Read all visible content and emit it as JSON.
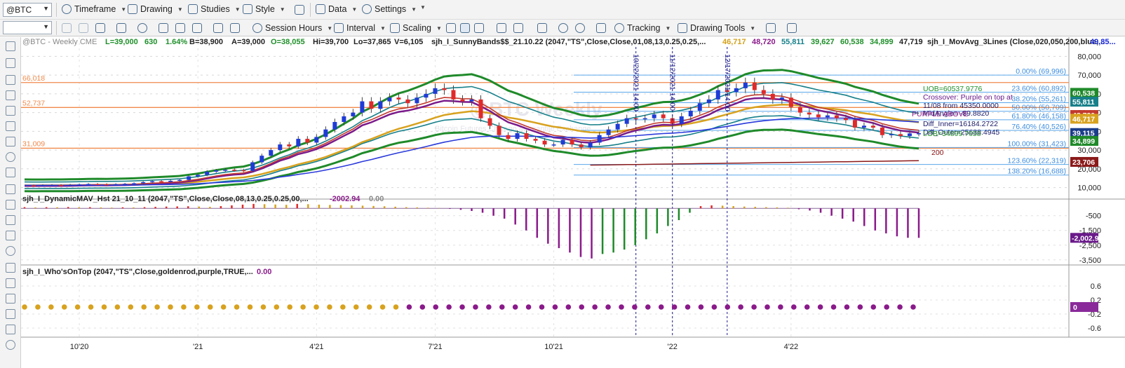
{
  "toolbar": {
    "symbol": "@BTC",
    "timeframe": "Timeframe",
    "drawing": "Drawing",
    "studies": "Studies",
    "style": "Style",
    "data": "Data",
    "settings": "Settings",
    "session_hours": "Session Hours",
    "interval": "Interval",
    "scaling": "Scaling",
    "tracking": "Tracking",
    "drawing_tools": "Drawing Tools"
  },
  "header": {
    "symbol_title": "@BTC - Weekly  CME",
    "watermark": "@BTC Weekly",
    "watermark_sub": "Bitcoin Futures  Chicago Mercantile Exchange",
    "L": "L=39,000",
    "chg": "630",
    "pct": "1.64%",
    "B": "B=38,900",
    "A": "A=39,000",
    "O": "O=38,055",
    "Hi": "Hi=39,700",
    "Lo": "Lo=37,865",
    "V": "V=6,105",
    "study1": "sjh_I_SunnyBands$$_21.10.22 (2047,\"TS\",Close,Close,01,08,13,0.25,0.25,...",
    "v1": "46,717",
    "v2": "48,720",
    "v3": "55,811",
    "v4": "39,627",
    "v5": "60,538",
    "v6": "34,899",
    "v7": "47,719",
    "study2": "sjh_I_MovAvg_3Lines (Close,020,050,200,blue,...",
    "v8": "49,85..."
  },
  "panel2": {
    "title": "sjh_I_DynamicMAV_Hst 21_10_11 (2047,\"TS\",Close,Close,08,13,0.25,0.25,00,...",
    "v1": "-2002.94",
    "v2": "0.00"
  },
  "panel3": {
    "title": "sjh_I_Who'sOnTop (2047,\"TS\",Close,goldenrod,purple,TRUE,...",
    "v1": "0.00"
  },
  "annotations": {
    "levels": [
      {
        "label": "66,018",
        "value": 66018
      },
      {
        "label": "52,737",
        "value": 52737
      },
      {
        "label": "31,009",
        "value": 31009
      }
    ],
    "fib": [
      {
        "label": "0.00% (69,996)",
        "value": 69996
      },
      {
        "label": "23.60% (60,892)",
        "value": 60892
      },
      {
        "label": "38.20% (55,261)",
        "value": 55261
      },
      {
        "label": "50.00% (50,709)",
        "value": 50709
      },
      {
        "label": "61.80% (46,158)",
        "value": 46158
      },
      {
        "label": "76.40% (40,526)",
        "value": 40526
      },
      {
        "label": "100.00% (31,423)",
        "value": 31423
      },
      {
        "label": "123.60% (22,319)",
        "value": 22319
      },
      {
        "label": "138.20% (16,688)",
        "value": 16688
      }
    ],
    "notes": [
      {
        "text": "UOB=60537.9776",
        "color": "#1f8f2a"
      },
      {
        "text": "Crossover: Purple on top at",
        "color": "#6a1a8a"
      },
      {
        "text": "11/08 from 45350.0000",
        "color": "#1a1a6a"
      },
      {
        "text": "MidAngle= -89.8820",
        "color": "#1a1a6a"
      },
      {
        "text": "PURPLE ABOVE",
        "color": "#8a1a8a"
      },
      {
        "text": "Diff_Inner=16184.2722",
        "color": "#1a1a6a"
      },
      {
        "text": "Diff_Outer=25638.4945",
        "color": "#1a1a6a"
      },
      {
        "text": "LOB=34899.7658",
        "color": "#1f8f2a"
      },
      {
        "text": "200",
        "color": "#8b1010"
      }
    ],
    "vlines": [
      {
        "label": "10/22/2021 14:00"
      },
      {
        "label": "11/12/2021 14:00"
      },
      {
        "label": "12/17/2021 14:00"
      }
    ]
  },
  "price_tags": [
    {
      "label": "60,538",
      "value": 60538,
      "color": "#1f8a2a"
    },
    {
      "label": "55,811",
      "value": 55811,
      "color": "#17808a"
    },
    {
      "label": "48,720",
      "value": 48720,
      "color": "#c23a2e"
    },
    {
      "label": "46,717",
      "value": 46717,
      "color": "#d8a21e"
    },
    {
      "label": "39,115",
      "value": 39115,
      "color": "#1a3d8a"
    },
    {
      "label": "34,899",
      "value": 34899,
      "color": "#1f8a2a"
    },
    {
      "label": "23,706",
      "value": 23706,
      "color": "#8b1a1a"
    }
  ],
  "panel2_tag": {
    "label": "-2,002.9",
    "color": "#6a1a8a"
  },
  "panel3_tag": {
    "label": "0",
    "color": "#8a2a9a"
  },
  "chart_data": [
    {
      "type": "candlestick",
      "title": "@BTC - Weekly  CME",
      "x_tick_labels": [
        "10'20",
        "'21",
        "4'21",
        "7'21",
        "10'21",
        "'22",
        "4'22"
      ],
      "y_tick_labels": [
        "80,000",
        "70,000",
        "60,000",
        "50,000",
        "40,000",
        "30,000",
        "20,000",
        "10,000"
      ],
      "ylim": [
        5000,
        85000
      ],
      "scale": "linear-approx",
      "weeks": 88,
      "close": [
        11200,
        11000,
        11300,
        11400,
        11200,
        11500,
        11700,
        11900,
        11800,
        11400,
        11800,
        12000,
        12300,
        12900,
        13400,
        13300,
        13600,
        14100,
        16000,
        16800,
        18500,
        19200,
        19500,
        19300,
        18900,
        23500,
        27000,
        30000,
        33000,
        32000,
        36000,
        34000,
        37000,
        41000,
        45000,
        48000,
        50000,
        56000,
        52000,
        56000,
        58000,
        57000,
        55000,
        58000,
        60000,
        63000,
        62000,
        57000,
        56000,
        57000,
        47000,
        43000,
        38000,
        36000,
        39000,
        36000,
        35000,
        33000,
        33000,
        35500,
        33000,
        31500,
        34000,
        38000,
        41000,
        44000,
        47000,
        46500,
        47000,
        49000,
        47000,
        44000,
        48000,
        51000,
        55000,
        57000,
        62000,
        61000,
        63000,
        66000,
        62000,
        60000,
        57000,
        58000,
        53000,
        50000,
        49000,
        47500,
        48500,
        47000,
        46000,
        42000,
        43000,
        42000,
        38000,
        38500,
        37500,
        38900,
        39000
      ],
      "ma_fast_blue_last": 48720,
      "ma_mid_goldenrod_last": 46717,
      "ma_200_last": 23706,
      "sunny_outer_upper_last": 60538,
      "sunny_inner_upper_last": 55811,
      "sunny_outer_lower_last": 34899,
      "sunny_inner_lower_last": 39115
    },
    {
      "type": "bar",
      "title": "sjh_I_DynamicMAV_Hst 21_10_11",
      "y_tick_labels": [
        "-500",
        "-1,500",
        "-2,500",
        "-3,500"
      ],
      "ylim": [
        -3700,
        200
      ],
      "values": [
        80,
        60,
        80,
        70,
        90,
        70,
        80,
        60,
        50,
        70,
        60,
        80,
        100,
        120,
        130,
        140,
        120,
        100,
        150,
        200,
        250,
        300,
        280,
        260,
        240,
        300,
        280,
        250,
        230,
        220,
        200,
        180,
        160,
        140,
        110,
        80,
        60,
        40,
        20,
        -40,
        -100,
        -180,
        -300,
        -500,
        -700,
        -1100,
        -1500,
        -2000,
        -2400,
        -2700,
        -3000,
        -3300,
        -3400,
        -3100,
        -3000,
        -2800,
        -2500,
        -2100,
        -1700,
        -1200,
        -800,
        -300,
        150,
        200,
        180,
        150,
        120,
        100,
        80,
        60,
        40,
        -60,
        -150,
        -300,
        -500,
        -700,
        -900,
        -1200,
        -1500,
        -1700,
        -1900,
        -2000,
        -2002.94
      ]
    },
    {
      "type": "scatter",
      "title": "sjh_I_Who'sOnTop",
      "y_tick_labels": [
        "0.6",
        "0.2",
        "-0.2",
        "-0.6"
      ],
      "ylim": [
        -0.8,
        0.8
      ],
      "dots": 68,
      "goldenrod_count": 29,
      "purple_count": 39
    }
  ]
}
